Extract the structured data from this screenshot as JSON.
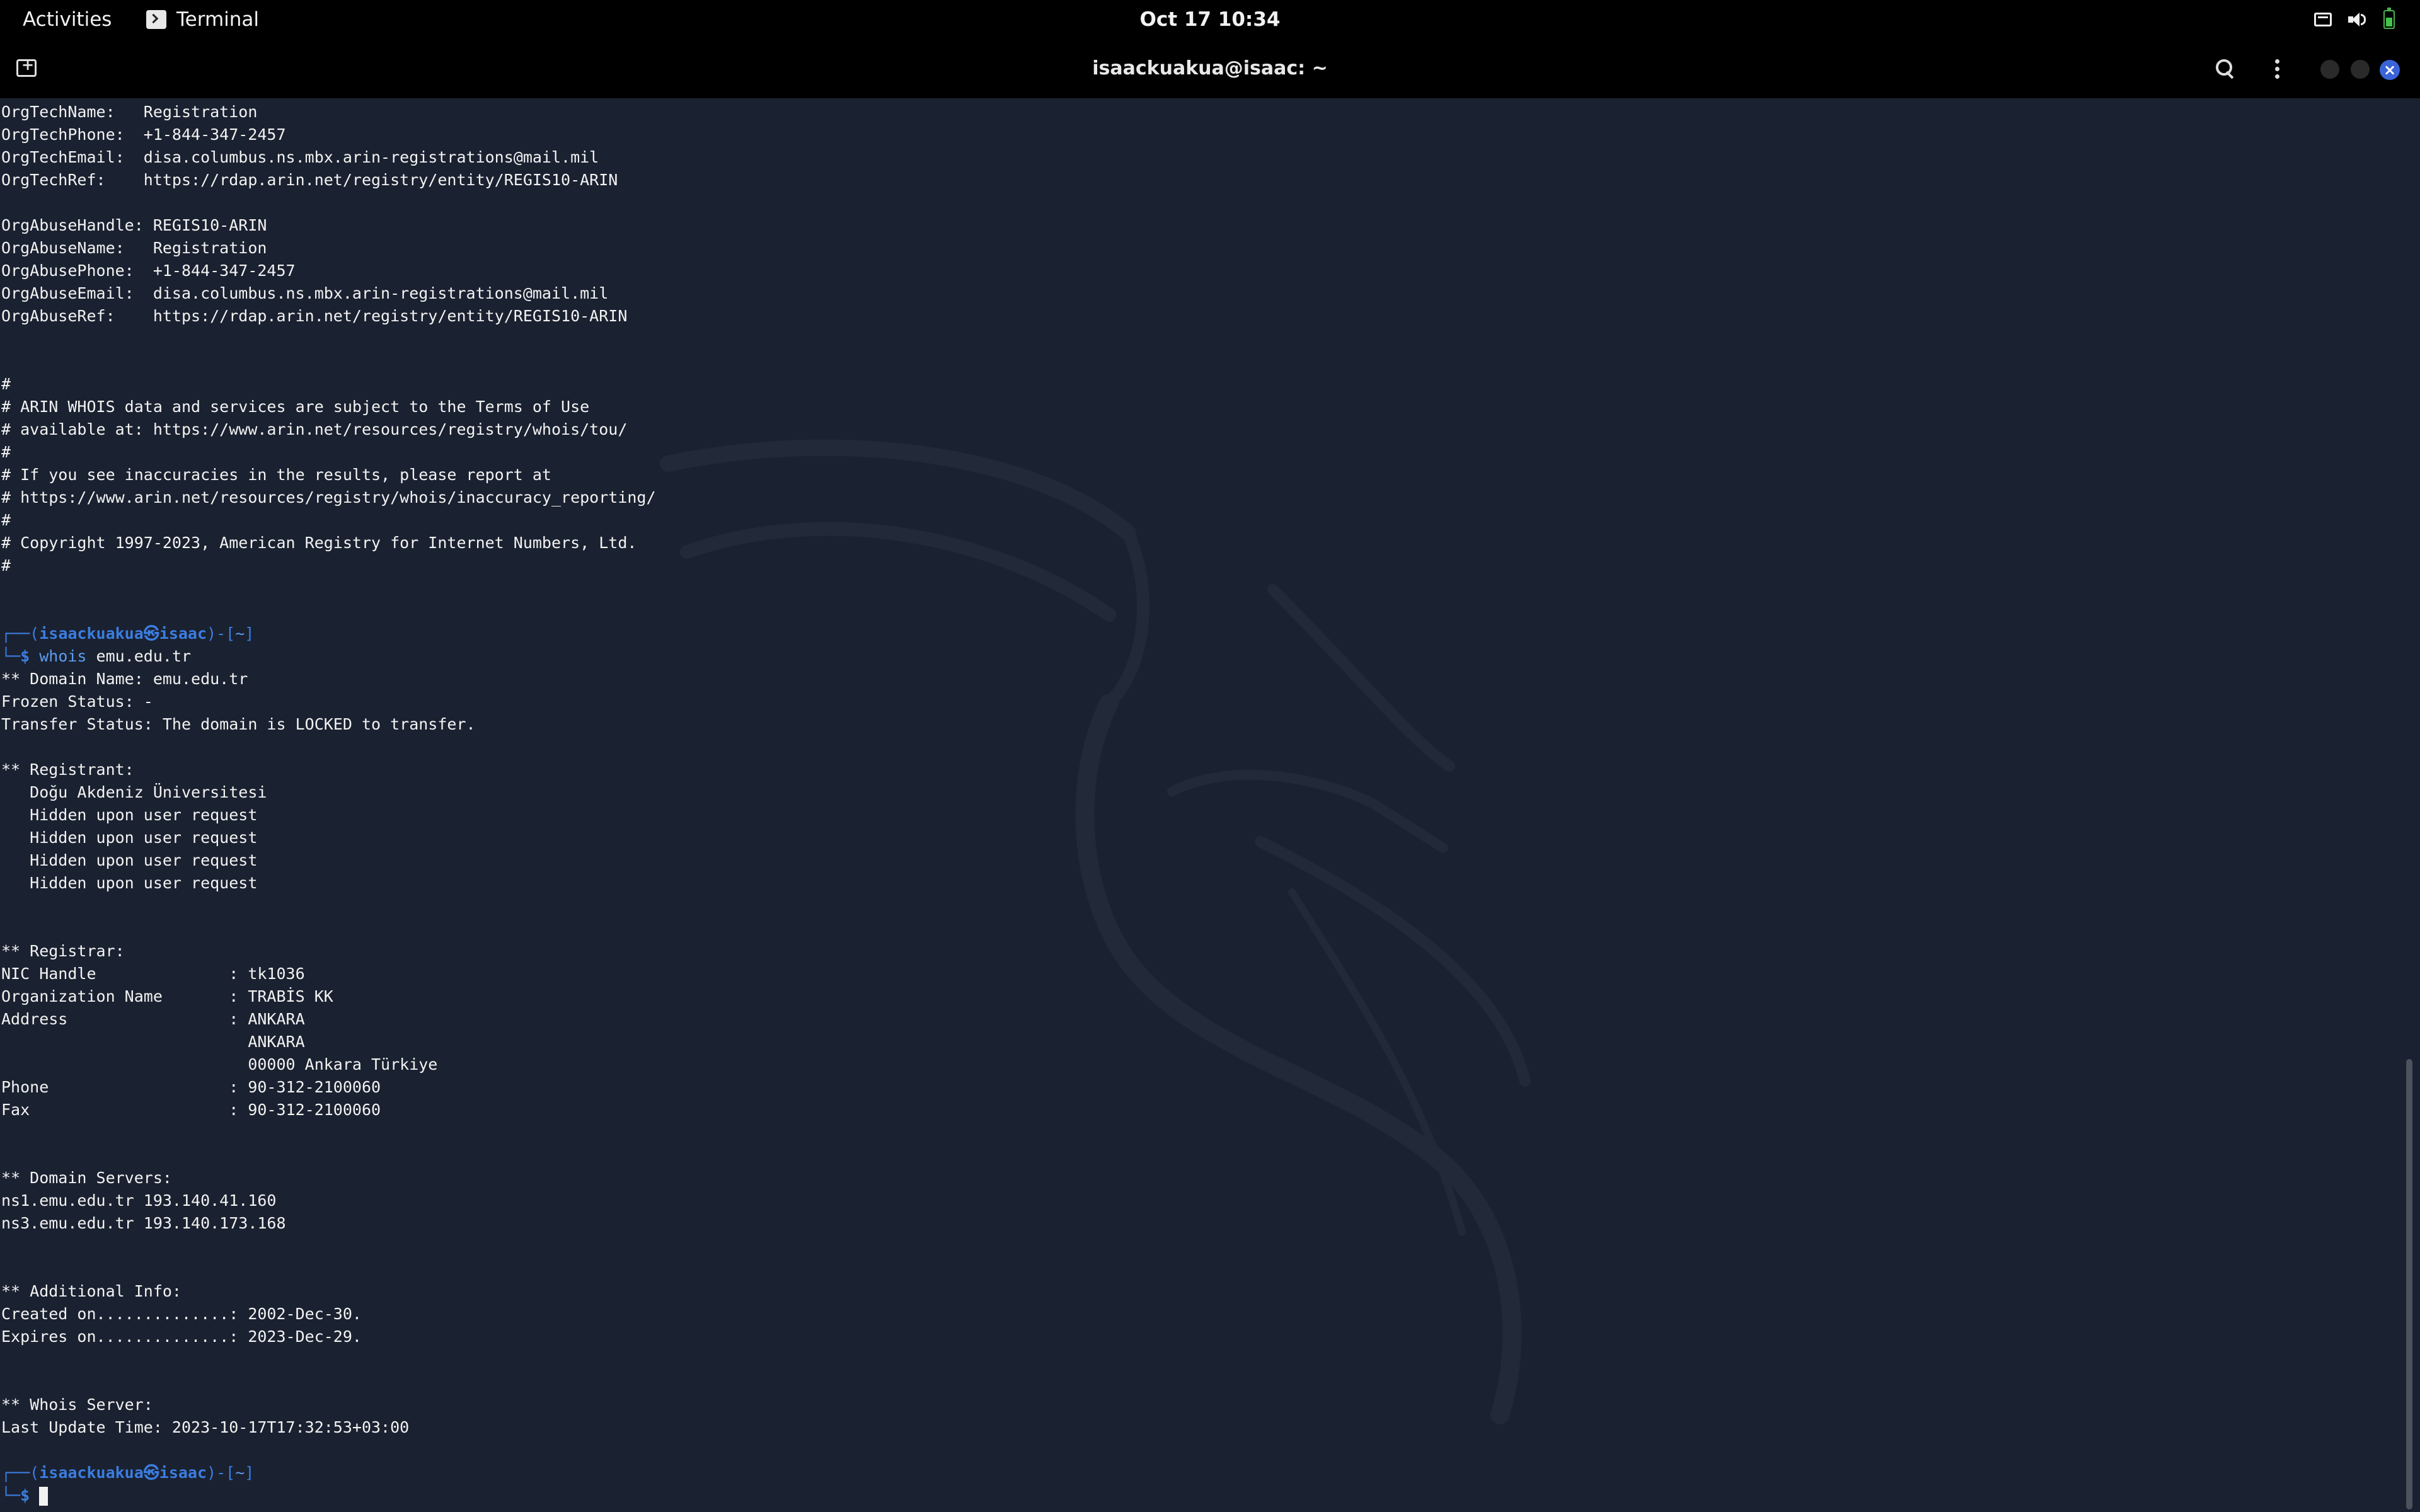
{
  "topbar": {
    "activities": "Activities",
    "app_name": "Terminal",
    "clock": "Oct 17  10:34"
  },
  "window": {
    "title": "isaackuakua@isaac: ~"
  },
  "terminal": {
    "lines": [
      "OrgTechName:   Registration",
      "OrgTechPhone:  +1-844-347-2457",
      "OrgTechEmail:  disa.columbus.ns.mbx.arin-registrations@mail.mil",
      "OrgTechRef:    https://rdap.arin.net/registry/entity/REGIS10-ARIN",
      "",
      "OrgAbuseHandle: REGIS10-ARIN",
      "OrgAbuseName:   Registration",
      "OrgAbusePhone:  +1-844-347-2457",
      "OrgAbuseEmail:  disa.columbus.ns.mbx.arin-registrations@mail.mil",
      "OrgAbuseRef:    https://rdap.arin.net/registry/entity/REGIS10-ARIN",
      "",
      "",
      "#",
      "# ARIN WHOIS data and services are subject to the Terms of Use",
      "# available at: https://www.arin.net/resources/registry/whois/tou/",
      "#",
      "# If you see inaccuracies in the results, please report at",
      "# https://www.arin.net/resources/registry/whois/inaccuracy_reporting/",
      "#",
      "# Copyright 1997-2023, American Registry for Internet Numbers, Ltd.",
      "#",
      "",
      "",
      {
        "prompt": {
          "user": "isaackuakua",
          "host": "isaac",
          "dir": "~"
        }
      },
      {
        "command": {
          "cmd": "whois",
          "args": " emu.edu.tr"
        }
      },
      "** Domain Name: emu.edu.tr",
      "Frozen Status: -",
      "Transfer Status: The domain is LOCKED to transfer.",
      "",
      "** Registrant:",
      "   Doğu Akdeniz Üniversitesi",
      "   Hidden upon user request",
      "   Hidden upon user request",
      "   Hidden upon user request",
      "   Hidden upon user request",
      "",
      "",
      "** Registrar:",
      "NIC Handle              : tk1036",
      "Organization Name       : TRABİS KK",
      "Address                 : ANKARA",
      "                          ANKARA",
      "                          00000 Ankara Türkiye",
      "Phone                   : 90-312-2100060",
      "Fax                     : 90-312-2100060",
      "",
      "",
      "** Domain Servers:",
      "ns1.emu.edu.tr 193.140.41.160",
      "ns3.emu.edu.tr 193.140.173.168",
      "",
      "",
      "** Additional Info:",
      "Created on..............: 2002-Dec-30.",
      "Expires on..............: 2023-Dec-29.",
      "",
      "",
      "** Whois Server:",
      "Last Update Time: 2023-10-17T17:32:53+03:00",
      "",
      {
        "prompt": {
          "user": "isaackuakua",
          "host": "isaac",
          "dir": "~"
        }
      },
      {
        "input": {
          "cmd": "",
          "cursor": true
        }
      }
    ]
  }
}
